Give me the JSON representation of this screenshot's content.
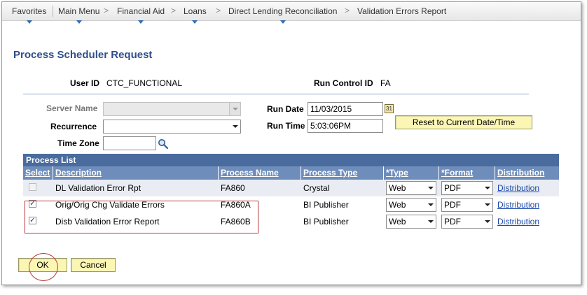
{
  "breadcrumb": {
    "items": [
      "Favorites",
      "Main Menu",
      "Financial Aid",
      "Loans",
      "Direct Lending Reconciliation",
      "Validation Errors Report"
    ],
    "separator": ">"
  },
  "page": {
    "title": "Process Scheduler Request"
  },
  "fields": {
    "user_id_label": "User ID",
    "user_id_value": "CTC_FUNCTIONAL",
    "run_control_label": "Run Control ID",
    "run_control_value": "FA",
    "server_name_label": "Server Name",
    "server_name_value": "",
    "recurrence_label": "Recurrence",
    "recurrence_value": "",
    "time_zone_label": "Time Zone",
    "time_zone_value": "",
    "run_date_label": "Run Date",
    "run_date_value": "11/03/2015",
    "run_time_label": "Run Time",
    "run_time_value": "5:03:06PM",
    "reset_button": "Reset to Current Date/Time"
  },
  "process_list": {
    "title": "Process List",
    "columns": [
      "Select",
      "Description",
      "Process Name",
      "Process Type",
      "*Type",
      "*Format",
      "Distribution"
    ],
    "rows": [
      {
        "selected": false,
        "description": "DL Validation Error Rpt",
        "process_name": "FA860",
        "process_type": "Crystal",
        "type": "Web",
        "format": "PDF",
        "distribution": "Distribution"
      },
      {
        "selected": true,
        "description": "Orig/Orig Chg Validate Errors",
        "process_name": "FA860A",
        "process_type": "BI Publisher",
        "type": "Web",
        "format": "PDF",
        "distribution": "Distribution"
      },
      {
        "selected": true,
        "description": "Disb Validation Error Report",
        "process_name": "FA860B",
        "process_type": "BI Publisher",
        "type": "Web",
        "format": "PDF",
        "distribution": "Distribution"
      }
    ]
  },
  "buttons": {
    "ok": "OK",
    "cancel": "Cancel"
  },
  "colors": {
    "title": "#2f4f8a",
    "grid_header": "#4a6b9e",
    "annotation": "#b83a3a",
    "button_bg": "#fbf6b4"
  }
}
